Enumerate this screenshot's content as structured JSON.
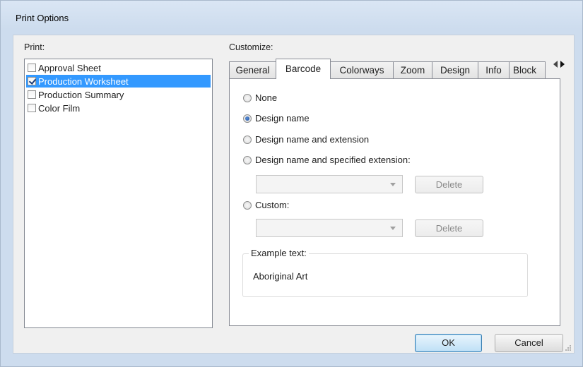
{
  "window": {
    "title": "Print Options"
  },
  "print": {
    "label": "Print:",
    "items": [
      {
        "label": "Approval Sheet",
        "checked": false,
        "selected": false
      },
      {
        "label": "Production Worksheet",
        "checked": true,
        "selected": true
      },
      {
        "label": "Production Summary",
        "checked": false,
        "selected": false
      },
      {
        "label": "Color Film",
        "checked": false,
        "selected": false
      }
    ]
  },
  "customize": {
    "label": "Customize:",
    "tabs": [
      {
        "label": "General",
        "active": false
      },
      {
        "label": "Barcode",
        "active": true
      },
      {
        "label": "Colorways",
        "active": false
      },
      {
        "label": "Zoom",
        "active": false
      },
      {
        "label": "Design",
        "active": false
      },
      {
        "label": "Info",
        "active": false
      },
      {
        "label": "Block",
        "active": false
      }
    ]
  },
  "barcode": {
    "options": [
      {
        "label": "None",
        "selected": false
      },
      {
        "label": "Design name",
        "selected": true
      },
      {
        "label": "Design name and extension",
        "selected": false
      },
      {
        "label": "Design name and specified extension:",
        "selected": false
      },
      {
        "label": "Custom:",
        "selected": false
      }
    ],
    "extension_combo_value": "",
    "custom_combo_value": "",
    "delete_label": "Delete",
    "example": {
      "legend": "Example text:",
      "text": "Aboriginal Art"
    }
  },
  "footer": {
    "ok_label": "OK",
    "cancel_label": "Cancel"
  },
  "colors": {
    "selection": "#3399ff",
    "accent_border": "#3c7fb1"
  }
}
